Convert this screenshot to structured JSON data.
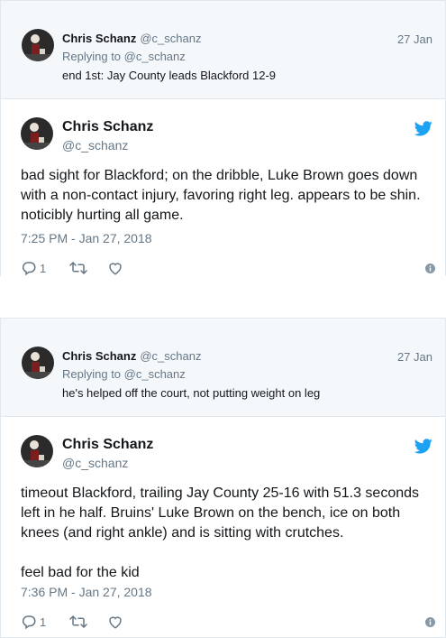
{
  "threads": [
    {
      "parent": {
        "name": "Chris Schanz",
        "handle": "@c_schanz",
        "date": "27 Jan",
        "replying_to": "Replying to @c_schanz",
        "text": "end 1st: Jay County leads Blackford 12-9"
      },
      "tweet": {
        "name": "Chris Schanz",
        "handle": "@c_schanz",
        "paragraphs": [
          "bad sight for Blackford; on the dribble, Luke Brown goes down with a non-contact injury, favoring right leg. appears to be shin. noticibly hurting all game."
        ],
        "timestamp": "7:25 PM - Jan 27, 2018",
        "reply_count": "1"
      }
    },
    {
      "parent": {
        "name": "Chris Schanz",
        "handle": "@c_schanz",
        "date": "27 Jan",
        "replying_to": "Replying to @c_schanz",
        "text": "he's helped off the court, not putting weight on leg"
      },
      "tweet": {
        "name": "Chris Schanz",
        "handle": "@c_schanz",
        "paragraphs": [
          "timeout Blackford, trailing Jay County 25-16 with 51.3 seconds left in he half. Bruins' Luke Brown on the bench, ice on both knees (and right ankle) and is sitting with crutches.",
          "feel bad for the kid"
        ],
        "timestamp": "7:36 PM - Jan 27, 2018",
        "reply_count": "1"
      }
    }
  ],
  "icons": {
    "bird": "twitter-bird-icon",
    "reply": "reply-icon",
    "retweet": "retweet-icon",
    "like": "like-icon",
    "info": "info-icon"
  },
  "colors": {
    "brand": "#1da1f2",
    "muted": "#657786",
    "text": "#14171a",
    "parent_bg": "#f5f8fa",
    "border": "#e1e8ed"
  }
}
